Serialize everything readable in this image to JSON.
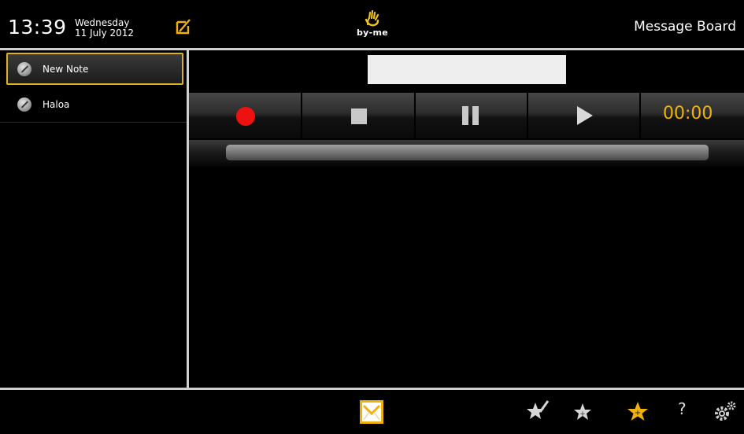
{
  "header": {
    "time": "13:39",
    "weekday": "Wednesday",
    "date": "11 July 2012",
    "logo_text": "by-me",
    "title": "Message Board"
  },
  "notes": [
    {
      "label": "New Note",
      "selected": true
    },
    {
      "label": "Haloa",
      "selected": false
    }
  ],
  "player": {
    "timer": "00:00"
  },
  "bottombar": {
    "help_label": "?"
  },
  "colors": {
    "accent": "#f0b20a",
    "record": "#ee1111",
    "selection_border": "#d9b12a",
    "divider": "#cfcfcf"
  },
  "icons": [
    "edit-icon",
    "byme-logo-icon",
    "note-icon",
    "record-icon",
    "stop-icon",
    "pause-icon",
    "play-icon",
    "messages-icon",
    "star-pin-icon",
    "star-icon",
    "star-highlight-icon",
    "help-icon",
    "settings-icon"
  ]
}
